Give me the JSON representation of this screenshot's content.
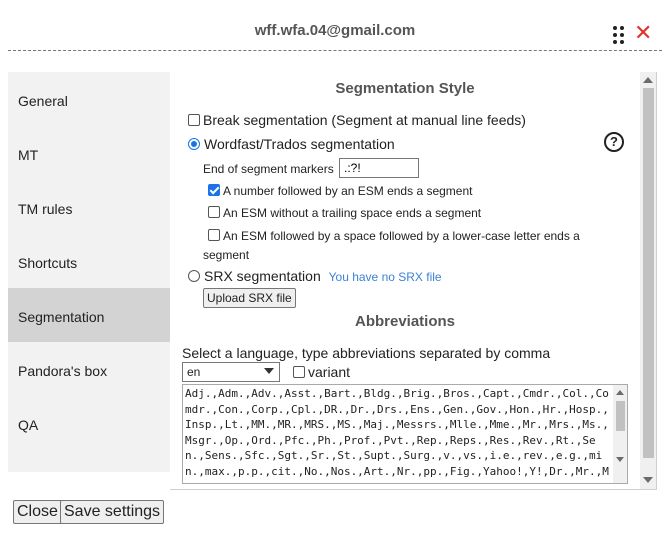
{
  "header": {
    "email": "wff.wfa.04@gmail.com"
  },
  "sidebar": {
    "items": [
      {
        "label": "General"
      },
      {
        "label": "MT"
      },
      {
        "label": "TM rules"
      },
      {
        "label": "Shortcuts"
      },
      {
        "label": "Segmentation",
        "active": true
      },
      {
        "label": "Pandora's box"
      },
      {
        "label": "QA"
      }
    ]
  },
  "segmentation": {
    "title": "Segmentation Style",
    "break_label": "Break segmentation (Segment at manual line feeds)",
    "break_checked": false,
    "wordfast_label": "Wordfast/Trados segmentation",
    "wordfast_selected": true,
    "esm_label": "End of segment markers",
    "esm_value": ".:?!",
    "opt1_label": "A number followed by an ESM ends a segment",
    "opt1_checked": true,
    "opt2_label": "An ESM without a trailing space ends a segment",
    "opt2_checked": false,
    "opt3_label_line1": "An ESM followed by a space followed by a lower-case letter ends a",
    "opt3_label_line2": "segment",
    "opt3_checked": false,
    "srx_label": "SRX segmentation",
    "srx_selected": false,
    "srx_note": "You have no SRX file",
    "upload_label": "Upload SRX file",
    "help_glyph": "?"
  },
  "abbreviations": {
    "title": "Abbreviations",
    "instruction": "Select a language, type abbreviations separated by comma",
    "language": "en",
    "variant_label": "variant",
    "variant_checked": false,
    "text": "Adj.,Adm.,Adv.,Asst.,Bart.,Bldg.,Brig.,Bros.,Capt.,Cmdr.,Col.,Comdr.,Con.,Corp.,Cpl.,DR.,Dr.,Drs.,Ens.,Gen.,Gov.,Hon.,Hr.,Hosp.,Insp.,Lt.,MM.,MR.,MRS.,MS.,Maj.,Messrs.,Mlle.,Mme.,Mr.,Mrs.,Ms.,Msgr.,Op.,Ord.,Pfc.,Ph.,Prof.,Pvt.,Rep.,Reps.,Res.,Rev.,Rt.,Sen.,Sens.,Sfc.,Sgt.,Sr.,St.,Supt.,Surg.,v.,vs.,i.e.,rev.,e.g.,min.,max.,p.p.,cit.,No.,Nos.,Art.,Nr.,pp.,Fig.,Yahoo!,Y!,Dr.,Mr.,Mrs.,Ms.,i.e.,e.g.,w.r.t.,approx.,ca.,cf.,vs.,fig.,St.,Ave.,Ste.,Ter"
  },
  "footer": {
    "close_label": "Close",
    "save_label": "Save settings"
  },
  "icons": {
    "drag": "drag-handle-icon",
    "close": "close-icon",
    "help": "help-icon"
  },
  "colors": {
    "accent": "#1a73e8",
    "close_red": "#e0322d",
    "link_blue": "#3b82d6",
    "active_tab": "#d3d3d3",
    "sidebar_bg": "#f2f2f2"
  }
}
